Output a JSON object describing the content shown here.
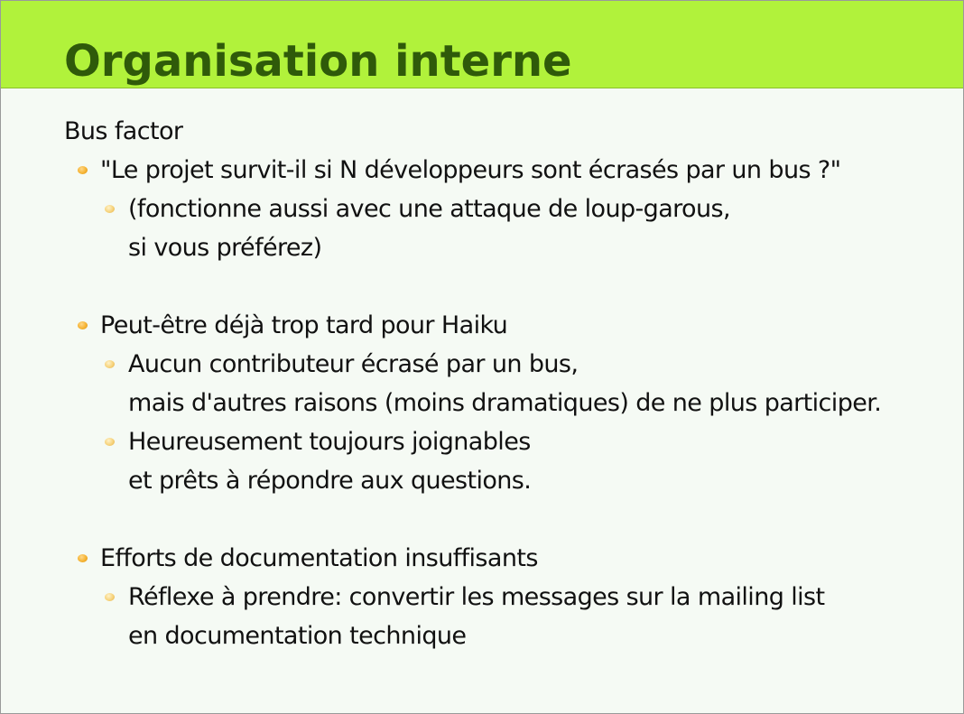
{
  "slide": {
    "title": "Organisation interne",
    "heading": "Bus factor",
    "items": [
      {
        "text": "\"Le projet survit-il si N développeurs sont écrasés par un bus ?\"",
        "children": [
          {
            "line1": "(fonctionne aussi avec une attaque de loup-garous,",
            "line2": "si vous préférez)"
          }
        ]
      },
      {
        "text": "Peut-être déjà trop tard pour Haiku",
        "children": [
          {
            "line1": "Aucun contributeur écrasé par un bus,",
            "line2": "mais d'autres raisons (moins dramatiques) de ne plus participer."
          },
          {
            "line1": "Heureusement toujours joignables",
            "line2": "et prêts à répondre aux questions."
          }
        ]
      },
      {
        "text": "Efforts de documentation insuffisants",
        "children": [
          {
            "line1": "Réflexe à prendre: convertir les messages sur la mailing list",
            "line2": "en documentation technique"
          }
        ]
      }
    ]
  },
  "colors": {
    "title_bar": "#b1f23b",
    "title_text": "#2f5a0a",
    "background": "#f5faf4",
    "bullet": "#f5b332",
    "sub_bullet": "#f6d27a"
  }
}
